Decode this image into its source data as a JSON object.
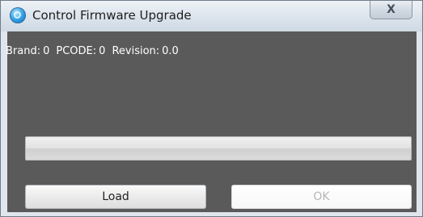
{
  "window": {
    "title": "Control Firmware Upgrade",
    "close_glyph": "X",
    "app_icon": "app-globe-icon"
  },
  "info": {
    "brand_label": "Brand:",
    "brand_value": "0",
    "pcode_label": "PCODE:",
    "pcode_value": "0",
    "revision_label": "Revision:",
    "revision_value": "0.0"
  },
  "progress": {
    "value": 0
  },
  "buttons": {
    "load_label": "Load",
    "ok_label": "OK"
  },
  "colors": {
    "content_bg": "#5a5a5a",
    "disabled_text": "#b7b7b7"
  }
}
